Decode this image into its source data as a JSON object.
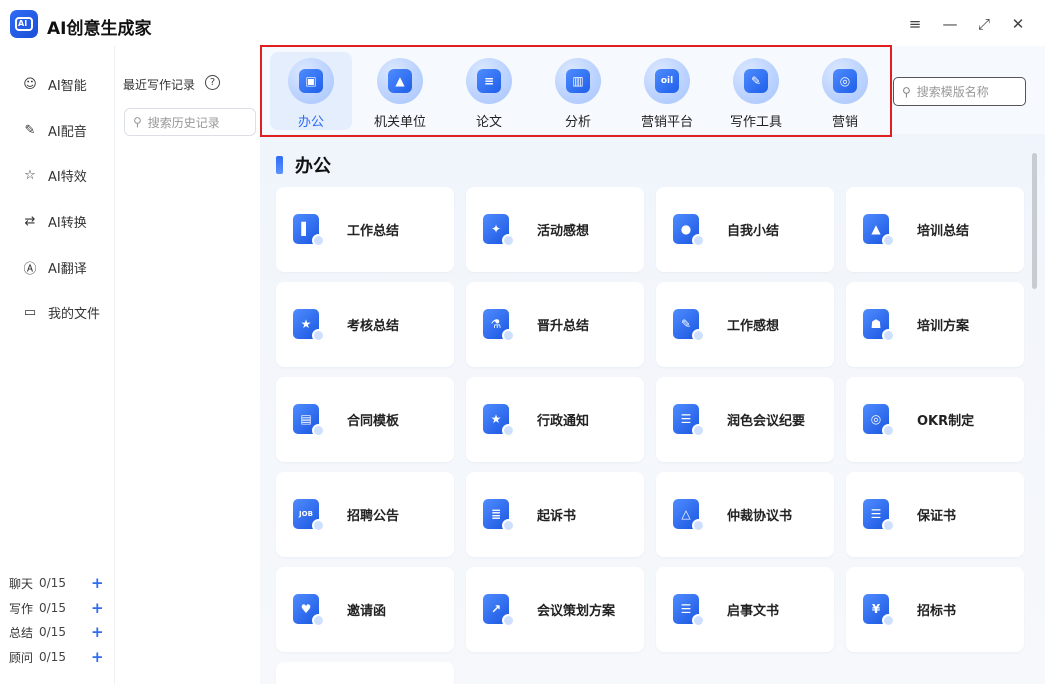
{
  "app": {
    "title": "AI创意生成家",
    "logo_text": "AI"
  },
  "window_controls": [
    "≡",
    "—",
    "⤢",
    "✕"
  ],
  "nav": [
    {
      "label": "AI智能",
      "icon": "robot-icon",
      "glyph": "☺"
    },
    {
      "label": "AI配音",
      "icon": "voice-icon",
      "glyph": "✎"
    },
    {
      "label": "AI特效",
      "icon": "sparkle-icon",
      "glyph": "☆"
    },
    {
      "label": "AI转换",
      "icon": "convert-icon",
      "glyph": "⇄"
    },
    {
      "label": "AI翻译",
      "icon": "translate-icon",
      "glyph": "Ⓐ"
    },
    {
      "label": "我的文件",
      "icon": "folder-icon",
      "glyph": "▭"
    }
  ],
  "quotas": [
    {
      "label": "聊天",
      "value": "0/15"
    },
    {
      "label": "写作",
      "value": "0/15"
    },
    {
      "label": "总结",
      "value": "0/15"
    },
    {
      "label": "顾问",
      "value": "0/15"
    }
  ],
  "quota_plus": "+",
  "history": {
    "title": "最近写作记录",
    "help": "?",
    "search_placeholder": "搜索历史记录"
  },
  "categories": [
    {
      "label": "办公",
      "icon": "briefcase-icon",
      "glyph": "▣",
      "active": true
    },
    {
      "label": "机关单位",
      "icon": "building-icon",
      "glyph": "▲",
      "active": false
    },
    {
      "label": "论文",
      "icon": "document-icon",
      "glyph": "≡",
      "active": false
    },
    {
      "label": "分析",
      "icon": "chart-icon",
      "glyph": "▥",
      "active": false
    },
    {
      "label": "营销平台",
      "icon": "screen-icon",
      "glyph": "oil",
      "active": false
    },
    {
      "label": "写作工具",
      "icon": "pen-icon",
      "glyph": "✎",
      "active": false
    },
    {
      "label": "营销",
      "icon": "target-icon",
      "glyph": "◎",
      "active": false
    }
  ],
  "template_search": {
    "placeholder": "搜索模版名称"
  },
  "section": {
    "title": "办公"
  },
  "cards": [
    {
      "label": "工作总结",
      "icon": "book-icon",
      "glyph": "▌"
    },
    {
      "label": "活动感想",
      "icon": "gift-icon",
      "glyph": "✦"
    },
    {
      "label": "自我小结",
      "icon": "person-icon",
      "glyph": "●"
    },
    {
      "label": "培训总结",
      "icon": "graduation-cap-icon",
      "glyph": "▲"
    },
    {
      "label": "考核总结",
      "icon": "star-doc-icon",
      "glyph": "★"
    },
    {
      "label": "晋升总结",
      "icon": "flask-icon",
      "glyph": "⚗"
    },
    {
      "label": "工作感想",
      "icon": "notebook-icon",
      "glyph": "✎"
    },
    {
      "label": "培训方案",
      "icon": "presenter-icon",
      "glyph": "☗"
    },
    {
      "label": "合同模板",
      "icon": "contract-icon",
      "glyph": "▤"
    },
    {
      "label": "行政通知",
      "icon": "notice-icon",
      "glyph": "★"
    },
    {
      "label": "润色会议纪要",
      "icon": "list-icon",
      "glyph": "☰"
    },
    {
      "label": "OKR制定",
      "icon": "target-icon",
      "glyph": "◎"
    },
    {
      "label": "招聘公告",
      "icon": "job-icon",
      "glyph": "JOB"
    },
    {
      "label": "起诉书",
      "icon": "binder-icon",
      "glyph": "≣"
    },
    {
      "label": "仲裁协议书",
      "icon": "agreement-icon",
      "glyph": "△"
    },
    {
      "label": "保证书",
      "icon": "pledge-icon",
      "glyph": "☰"
    },
    {
      "label": "邀请函",
      "icon": "invitation-icon",
      "glyph": "♥"
    },
    {
      "label": "会议策划方案",
      "icon": "trend-icon",
      "glyph": "↗"
    },
    {
      "label": "启事文书",
      "icon": "announcement-icon",
      "glyph": "☰"
    },
    {
      "label": "招标书",
      "icon": "tender-icon",
      "glyph": "¥"
    }
  ]
}
